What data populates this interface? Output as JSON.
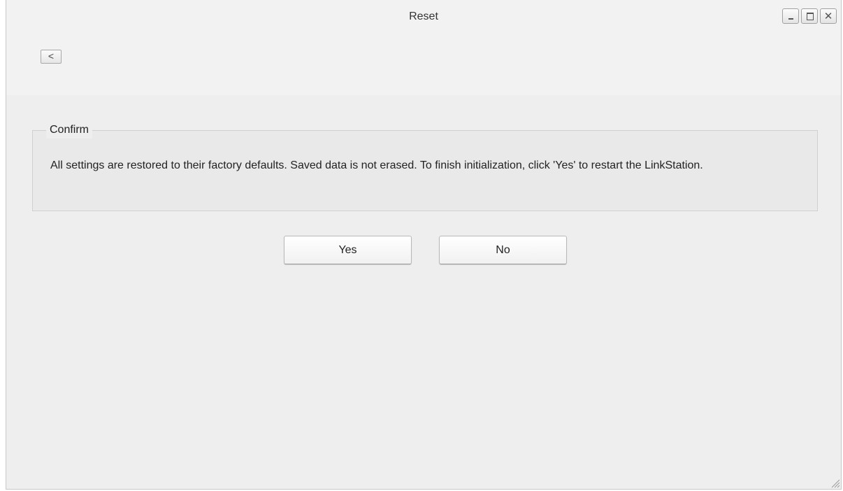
{
  "window": {
    "title": "Reset"
  },
  "window_controls": {
    "minimize_icon": "minimize-icon",
    "maximize_icon": "maximize-icon",
    "close_icon": "close-icon",
    "close_glyph": "✕"
  },
  "nav": {
    "back_label": "<"
  },
  "confirm": {
    "legend": "Confirm",
    "message": "All settings are restored to their factory defaults. Saved data is not erased. To finish initialization, click 'Yes' to restart the LinkStation."
  },
  "actions": {
    "yes_label": "Yes",
    "no_label": "No"
  },
  "colors": {
    "window_background": "#eeeeee",
    "titlebar_background": "#f2f2f2",
    "panel_background": "#e9e9e9",
    "text": "#222222"
  }
}
